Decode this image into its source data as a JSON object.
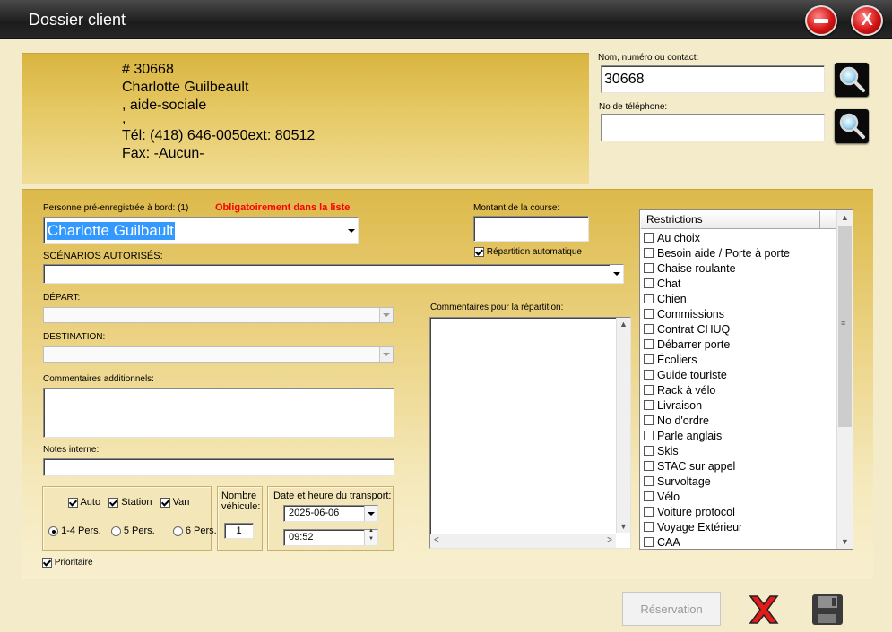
{
  "window": {
    "title": "Dossier client",
    "minimize_label": "",
    "close_label": "X"
  },
  "client": {
    "number": "# 30668",
    "name": "Charlotte Guilbeault",
    "line3": ", aide-sociale",
    "line4": ",",
    "phone": "Tél: (418) 646-0050ext: 80512",
    "fax": "Fax: -Aucun-"
  },
  "search": {
    "name_label": "Nom, numéro ou contact:",
    "name_value": "30668",
    "phone_label": "No de téléphone:",
    "phone_value": ""
  },
  "form": {
    "person_label": "Personne pré-enregistrée à bord: (1)",
    "person_required": "Obligatoirement dans la liste",
    "person_value": "Charlotte Guilbault",
    "scenarios_label": "SCÉNARIOS AUTORISÉS:",
    "scenarios_value": "",
    "depart_label": "DÉPART:",
    "destination_label": "DESTINATION:",
    "comments_add_label": "Commentaires additionnels:",
    "notes_label": "Notes interne:",
    "amount_label": "Montant de la course:",
    "amount_value": "",
    "auto_dispatch_label": "Répartition automatique",
    "auto_dispatch_checked": true,
    "dispatch_comments_label": "Commentaires pour la répartition:",
    "vehicles": {
      "auto": "Auto",
      "station": "Station",
      "van": "Van",
      "auto_checked": true,
      "station_checked": true,
      "van_checked": true,
      "p14": "1-4 Pers.",
      "p5": "5 Pers.",
      "p6": "6 Pers.",
      "selected": "1-4 Pers."
    },
    "vehicle_count_label1": "Nombre",
    "vehicle_count_label2": "véhicule:",
    "vehicle_count_value": "1",
    "datetime_label": "Date et heure du transport:",
    "date_value": "2025-06-06",
    "time_value": "09:52",
    "priority_label": "Prioritaire",
    "priority_checked": true
  },
  "restrictions": {
    "header": "Restrictions",
    "items": [
      "Au choix",
      "Besoin aide / Porte à porte",
      "Chaise roulante",
      "Chat",
      "Chien",
      "Commissions",
      "Contrat CHUQ",
      "Débarrer porte",
      "Écoliers",
      "Guide touriste",
      "Rack à vélo",
      "Livraison",
      "No d'ordre",
      "Parle anglais",
      "Skis",
      "STAC sur appel",
      "Survoltage",
      "Vélo",
      "Voiture protocol",
      "Voyage Extérieur",
      "CAA"
    ]
  },
  "actions": {
    "reservation_label": "Réservation"
  },
  "colors": {
    "accent_gold": "#dcb94a",
    "required_red": "#ff0000"
  }
}
